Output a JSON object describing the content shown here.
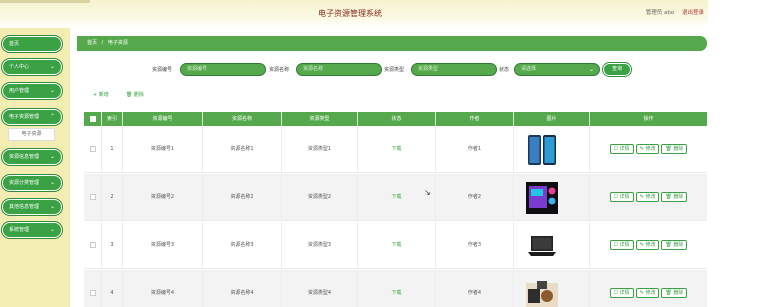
{
  "header": {
    "app_title": "电子资源管理系统",
    "user_label": "管理员 abo",
    "logout_label": "退出登录"
  },
  "sidebar": {
    "items": [
      {
        "label": "首页",
        "has_chevron": false
      },
      {
        "label": "个人中心",
        "has_chevron": true
      },
      {
        "label": "用户管理",
        "has_chevron": true
      },
      {
        "label": "电子资源管理",
        "has_chevron": true
      },
      {
        "label": "资源信息管理",
        "has_chevron": true
      },
      {
        "label": "资源分类管理",
        "has_chevron": true
      },
      {
        "label": "其他信息管理",
        "has_chevron": true
      },
      {
        "label": "系统管理",
        "has_chevron": true
      }
    ],
    "sub_item": "电子资源"
  },
  "breadcrumb": {
    "home": "首页",
    "separator": "/",
    "current": "电子资源"
  },
  "search": {
    "field1_label": "资源编号",
    "field1_placeholder": "资源编号",
    "field2_label": "资源名称",
    "field2_placeholder": "资源名称",
    "field3_label": "资源类型",
    "field3_placeholder": "资源类型",
    "field4_label": "状态",
    "field4_value": "请选择",
    "button_label": "查询"
  },
  "toolbar": {
    "add_label": "+ 新增",
    "delete_label": "🗑 删除"
  },
  "table": {
    "columns": [
      "",
      "索引",
      "资源编号",
      "资源名称",
      "资源类型",
      "状态",
      "作者",
      "图片",
      "操作"
    ],
    "rows": [
      {
        "index": "1",
        "code": "资源编号1",
        "name": "资源名称1",
        "type": "资源类型1",
        "status": "下载",
        "author": "作者1",
        "image": "phones"
      },
      {
        "index": "2",
        "code": "资源编号2",
        "name": "资源名称2",
        "type": "资源类型2",
        "status": "下载",
        "author": "作者2",
        "image": "pc-case"
      },
      {
        "index": "3",
        "code": "资源编号3",
        "name": "资源名称3",
        "type": "资源类型3",
        "status": "下载",
        "author": "作者3",
        "image": "laptop"
      },
      {
        "index": "4",
        "code": "资源编号4",
        "name": "资源名称4",
        "type": "资源类型4",
        "status": "下载",
        "author": "作者4",
        "image": "accessories"
      }
    ],
    "actions": {
      "view": "详情",
      "edit": "修改",
      "delete": "删除"
    }
  },
  "colors": {
    "primary_green": "#3aa145",
    "header_green": "#55a94c",
    "sidebar_bg": "#f4edb3",
    "title_red": "#8b2a2a"
  }
}
